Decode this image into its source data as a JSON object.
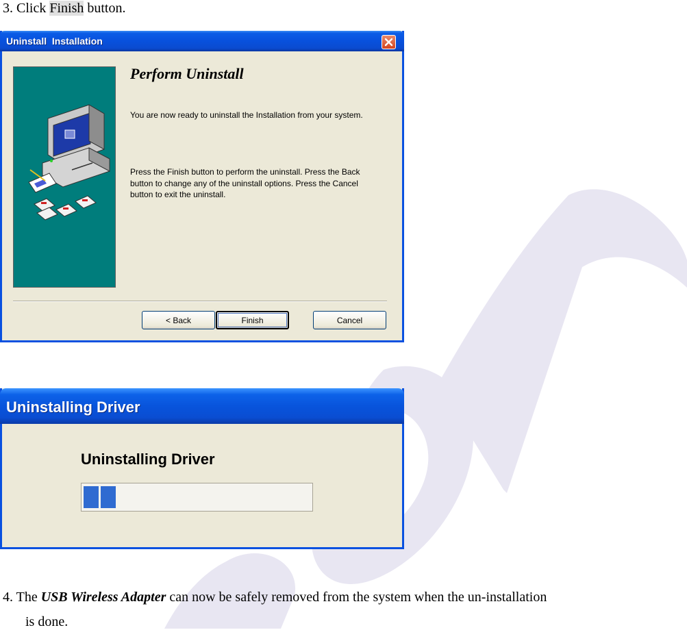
{
  "step3": {
    "prefix": "3. Click ",
    "highlight": "Finish",
    "suffix": " button."
  },
  "dialog1": {
    "title": "Uninstall  Installation",
    "heading": "Perform Uninstall",
    "para1": "You are now ready to uninstall the  Installation from your system.",
    "para2_lines": [
      "Press the Finish button to perform the uninstall. Press the Back",
      "button to change any of the uninstall options. Press the Cancel",
      "button to exit the uninstall."
    ],
    "buttons": {
      "back": "< Back",
      "finish": "Finish",
      "cancel": "Cancel"
    }
  },
  "dialog2": {
    "title": "Uninstalling Driver",
    "heading": "Uninstalling Driver",
    "progress_chunks": 2
  },
  "step4": {
    "prefix": "4. The ",
    "emphasis": "USB Wireless Adapter",
    "suffix": " can now be safely removed from the system when the un-installation",
    "line2": "is done."
  },
  "colors": {
    "titlebar_blue": "#0851dd",
    "dialog_bg": "#ece9d8",
    "side_panel": "#007d7c",
    "progress_fill": "#2f6bd1",
    "watermark": "#e8e6f2"
  }
}
